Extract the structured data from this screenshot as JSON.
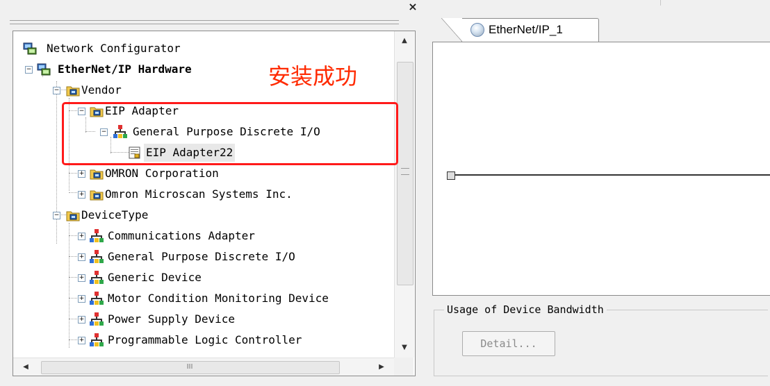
{
  "left_pane": {
    "close_label": "×",
    "tree": [
      {
        "label": "Network Configurator",
        "icon": "network-configurator-icon"
      },
      {
        "label": "EtherNet/IP Hardware",
        "icon": "ethernet-hardware-icon",
        "bold": true
      },
      {
        "label": "Vendor",
        "icon": "folder-icon"
      },
      {
        "label": "EIP Adapter",
        "icon": "folder-icon"
      },
      {
        "label": "General Purpose Discrete I/O",
        "icon": "device-type-icon"
      },
      {
        "label": "EIP Adapter22",
        "icon": "eds-device-icon",
        "selected": true
      },
      {
        "label": "OMRON Corporation",
        "icon": "folder-icon"
      },
      {
        "label": "Omron Microscan Systems Inc.",
        "icon": "folder-icon"
      },
      {
        "label": "DeviceType",
        "icon": "folder-icon"
      },
      {
        "label": "Communications Adapter",
        "icon": "device-type-icon"
      },
      {
        "label": "General Purpose Discrete I/O",
        "icon": "device-type-icon"
      },
      {
        "label": "Generic Device",
        "icon": "device-type-icon"
      },
      {
        "label": "Motor Condition Monitoring Device",
        "icon": "device-type-icon"
      },
      {
        "label": "Power Supply Device",
        "icon": "device-type-icon"
      },
      {
        "label": "Programmable Logic Controller",
        "icon": "device-type-icon"
      }
    ],
    "hscroll_grip": "III"
  },
  "annotation": {
    "text": "安装成功",
    "color": "#ff2a00"
  },
  "right_pane": {
    "tab_label": "EtherNet/IP_1",
    "bandwidth_title": "Usage of Device Bandwidth",
    "detail_button": "Detail..."
  }
}
